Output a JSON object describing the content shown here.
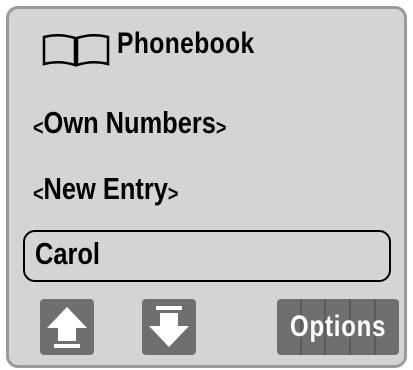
{
  "header": {
    "icon": "book-icon",
    "title": "Phonebook"
  },
  "menu": {
    "items": [
      {
        "open": "<",
        "label": "Own Numbers",
        "close": ">"
      },
      {
        "open": "<",
        "label": "New Entry",
        "close": ">"
      }
    ],
    "selected": {
      "label": "Carol"
    }
  },
  "softkeys": {
    "up": {
      "icon": "arrow-up-icon"
    },
    "down": {
      "icon": "arrow-down-icon"
    },
    "options": {
      "label": "Options"
    }
  },
  "colors": {
    "screen_bg": "#d4d4d4",
    "softkey_bg": "#6f6f6f",
    "text": "#000000"
  }
}
